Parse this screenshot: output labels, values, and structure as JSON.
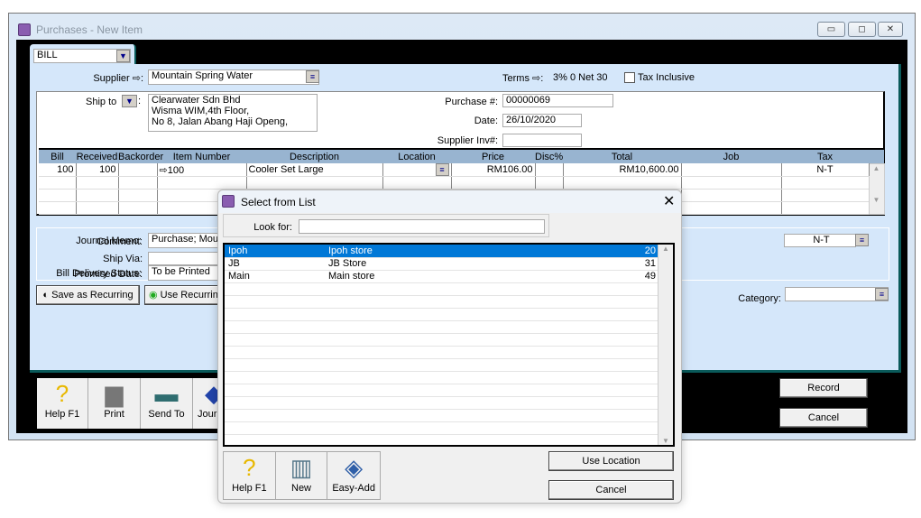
{
  "window": {
    "title": "Purchases - New Item",
    "min": "▭",
    "max": "◻",
    "close": "✕"
  },
  "form": {
    "type": "BILL",
    "supplier_label": "Supplier ⇨:",
    "supplier": "Mountain Spring Water",
    "terms_label": "Terms ⇨:",
    "terms": "3% 0 Net 30",
    "tax_inclusive_label": "Tax Inclusive",
    "tax_inclusive": false,
    "ship_to_label": "Ship to",
    "ship_to_lines": [
      "Clearwater Sdn Bhd",
      "Wisma WIM,4th Floor,",
      "No 8, Jalan Abang Haji Openg,"
    ],
    "purchase_no_label": "Purchase #:",
    "purchase_no": "00000069",
    "date_label": "Date:",
    "date": "26/10/2020",
    "supplier_inv_label": "Supplier Inv#:",
    "supplier_inv": "",
    "columns": [
      "Bill",
      "Received",
      "Backorder",
      "Item Number",
      "Description",
      "Location",
      "Price",
      "Disc%",
      "Total",
      "Job",
      "Tax"
    ],
    "lines": [
      {
        "bill": "100",
        "received": "100",
        "backorder": "",
        "item": "⇨100",
        "description": "Cooler Set Large",
        "location": "",
        "price": "RM106.00",
        "disc": "",
        "total": "RM10,600.00",
        "job": "",
        "tax": "N-T"
      }
    ],
    "comment_label": "Comment:",
    "ship_via_label": "Ship Via:",
    "promised_label": "Promised Date:",
    "freight_tax": "N-T",
    "memo_label": "Journal Memo:",
    "memo": "Purchase; Mountain Spring Water",
    "delivery_label": "Bill Delivery Status:",
    "delivery": "To be Printed",
    "save_recurring": "Save as Recurring",
    "use_recurring": "Use Recurring",
    "category_label": "Category:",
    "category": ""
  },
  "toolbar": {
    "help": "Help F1",
    "print": "Print",
    "send": "Send To",
    "journal": "Journal"
  },
  "actions": {
    "record": "Record",
    "cancel": "Cancel"
  },
  "dialog": {
    "title": "Select from List",
    "look_for_label": "Look for:",
    "look_for": "",
    "items": [
      {
        "code": "Ipoh",
        "name": "Ipoh store",
        "qty": "20",
        "selected": true
      },
      {
        "code": "JB",
        "name": "JB Store",
        "qty": "31"
      },
      {
        "code": "Main",
        "name": "Main store",
        "qty": "49"
      }
    ],
    "help": "Help F1",
    "new": "New",
    "easy_add": "Easy-Add",
    "use_location": "Use Location",
    "cancel": "Cancel"
  },
  "colors": {
    "panel": "#d5e7fa",
    "header": "#98b4d0",
    "selection": "#0078d7"
  }
}
